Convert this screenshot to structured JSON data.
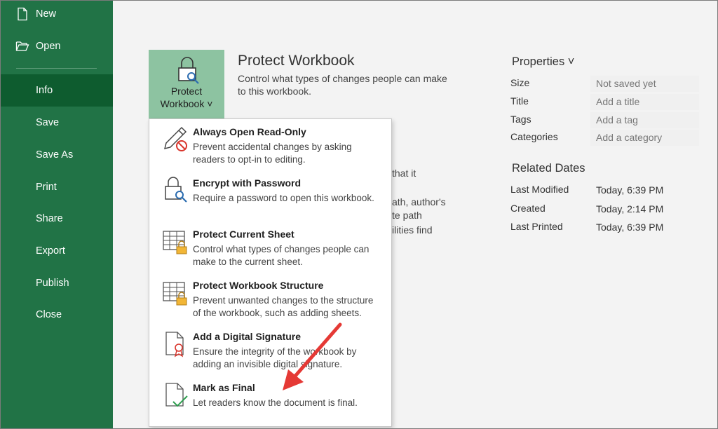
{
  "nav": {
    "new": "New",
    "open": "Open",
    "info": "Info",
    "save": "Save",
    "save_as": "Save As",
    "print": "Print",
    "share": "Share",
    "export": "Export",
    "publish": "Publish",
    "close": "Close"
  },
  "protect": {
    "button_line1": "Protect",
    "button_line2": "Workbook ˅",
    "title": "Protect Workbook",
    "description": "Control what types of changes people can make to this workbook.",
    "icon": "lock-key-icon"
  },
  "hidden_text": {
    "line1": "that it",
    "line2": "ath, author's",
    "line3": "te path",
    "line4": "ilities find"
  },
  "menu": {
    "items": [
      {
        "title": "Always Open Read-Only",
        "desc": "Prevent accidental changes by asking readers to opt-in to editing.",
        "icon": "pencil-no-icon"
      },
      {
        "title": "Encrypt with Password",
        "desc": "Require a password to open this workbook.",
        "icon": "lock-key-icon"
      },
      {
        "title": "Protect Current Sheet",
        "desc": "Control what types of changes people can make to the current sheet.",
        "icon": "sheet-lock-icon"
      },
      {
        "title": "Protect Workbook Structure",
        "desc": "Prevent unwanted changes to the structure of the workbook, such as adding sheets.",
        "icon": "workbook-lock-icon"
      },
      {
        "title": "Add a Digital Signature",
        "desc": "Ensure the integrity of the workbook by adding an invisible digital signature.",
        "icon": "signature-ribbon-icon"
      },
      {
        "title": "Mark as Final",
        "desc": "Let readers know the document is final.",
        "icon": "document-check-icon"
      }
    ]
  },
  "properties": {
    "title": "Properties ˅",
    "size_label": "Size",
    "size_value": "Not saved yet",
    "title_label": "Title",
    "title_value": "Add a title",
    "tags_label": "Tags",
    "tags_value": "Add a tag",
    "categories_label": "Categories",
    "categories_value": "Add a category"
  },
  "dates": {
    "title": "Related Dates",
    "last_modified_label": "Last Modified",
    "last_modified_value": "Today, 6:39 PM",
    "created_label": "Created",
    "created_value": "Today, 2:14 PM",
    "last_printed_label": "Last Printed",
    "last_printed_value": "Today, 6:39 PM"
  },
  "colors": {
    "nav_bg": "#217346",
    "nav_active": "#0e5c2f",
    "protect_button": "#8dc3a1",
    "arrow": "#e53935"
  }
}
